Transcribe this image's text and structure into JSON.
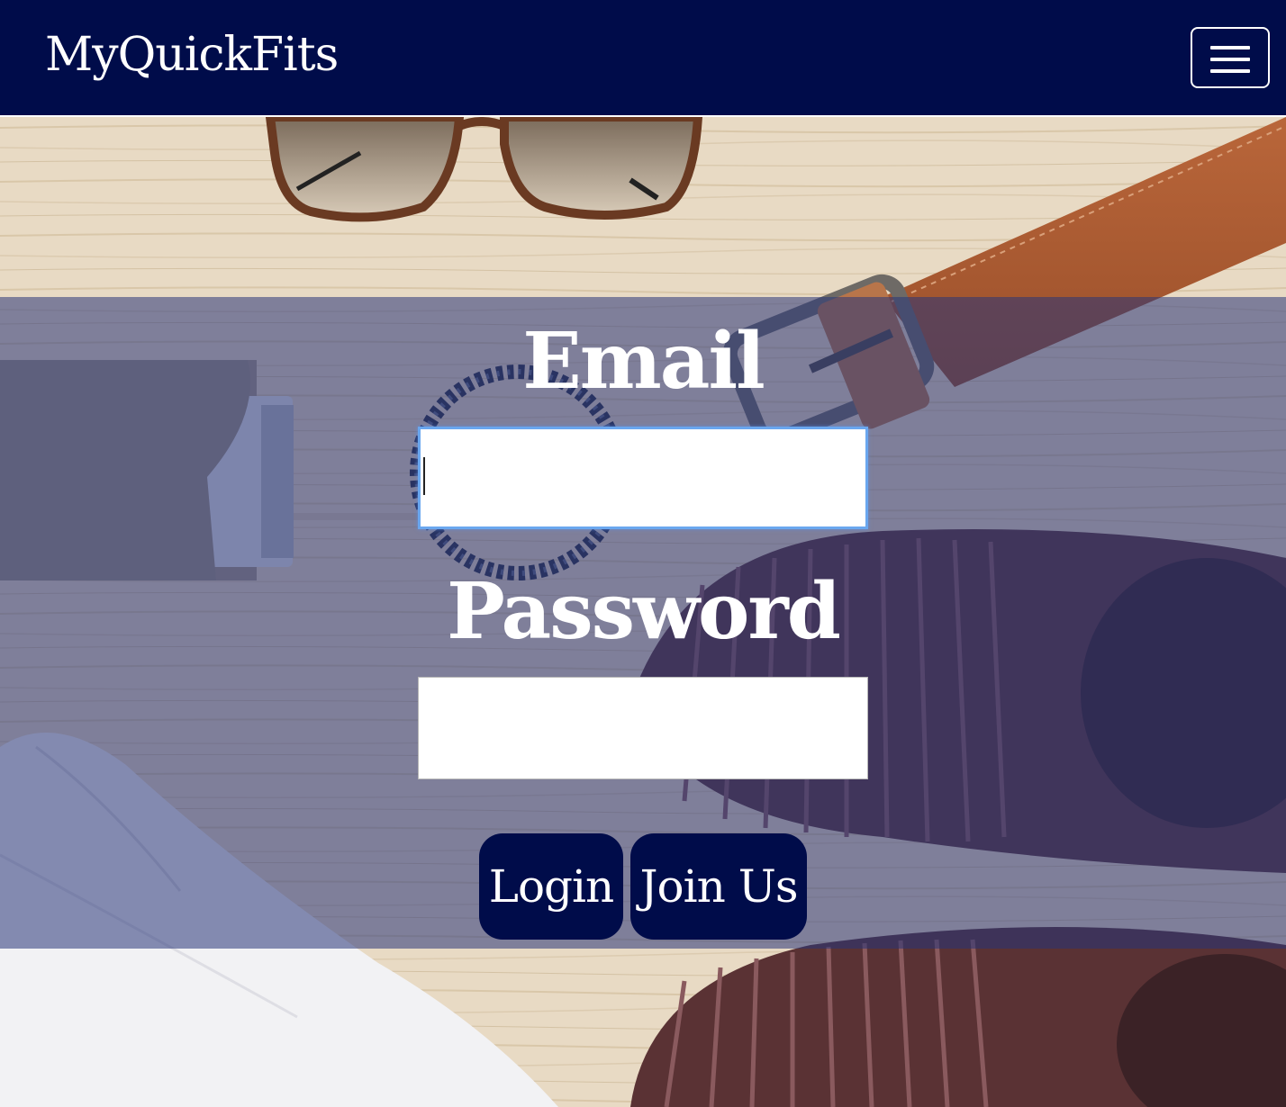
{
  "navbar": {
    "brand": "MyQuickFits",
    "toggle_icon": "hamburger-menu-icon",
    "background_color": "#000c4a"
  },
  "background_image": {
    "description_icons": [
      "sunglasses-image",
      "belt-image",
      "wallet-image",
      "bracelet-image",
      "sandals-image",
      "shirt-image"
    ]
  },
  "login_form": {
    "email_label": "Email",
    "email_value": "",
    "password_label": "Password",
    "password_value": "",
    "login_button": "Login",
    "join_button": "Join Us",
    "button_color": "#000c4a",
    "focus_color": "#6aa7ef"
  }
}
